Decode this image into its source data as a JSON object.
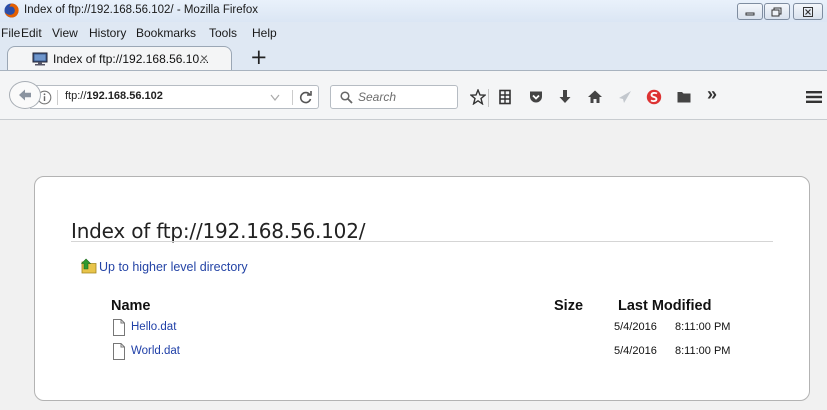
{
  "window": {
    "title": "Index of ftp://192.168.56.102/ - Mozilla Firefox",
    "icon": "firefox-icon",
    "controls": [
      "minimize-icon",
      "maximize-icon",
      "close-icon"
    ]
  },
  "menubar": {
    "items": [
      {
        "label": "File"
      },
      {
        "label": "Edit"
      },
      {
        "label": "View"
      },
      {
        "label": "History"
      },
      {
        "label": "Bookmarks"
      },
      {
        "label": "Tools"
      },
      {
        "label": "Help"
      }
    ]
  },
  "tabs": [
    {
      "title": "Index of ftp://192.168.56.10...",
      "close": "×",
      "icon": "monitor-icon"
    }
  ],
  "newtab_label": "+",
  "navbar": {
    "url_prefix": "ftp://",
    "url_host": "192.168.56.102",
    "search_placeholder": "Search",
    "toolbar_icons": [
      "star-icon",
      "reading-list-icon",
      "pocket-icon",
      "download-icon",
      "home-icon",
      "send-icon",
      "stylish-icon",
      "folder-icon",
      "overflow-icon",
      "menu-icon"
    ],
    "overflow_label": "»"
  },
  "listing": {
    "title": "Index of ftp://192.168.56.102/",
    "up_link": "Up to higher level directory",
    "columns": {
      "name": "Name",
      "size": "Size",
      "modified": "Last Modified"
    },
    "files": [
      {
        "name": "Hello.dat",
        "size": "",
        "date": "5/4/2016",
        "time": "8:11:00 PM"
      },
      {
        "name": "World.dat",
        "size": "",
        "date": "5/4/2016",
        "time": "8:11:00 PM"
      }
    ]
  },
  "colors": {
    "link": "#2444a6",
    "chrome_bg": "#dfe8f3",
    "content_bg": "#f1f1f1",
    "firefox_orange": "#e66000",
    "stylish_red": "#d33"
  }
}
